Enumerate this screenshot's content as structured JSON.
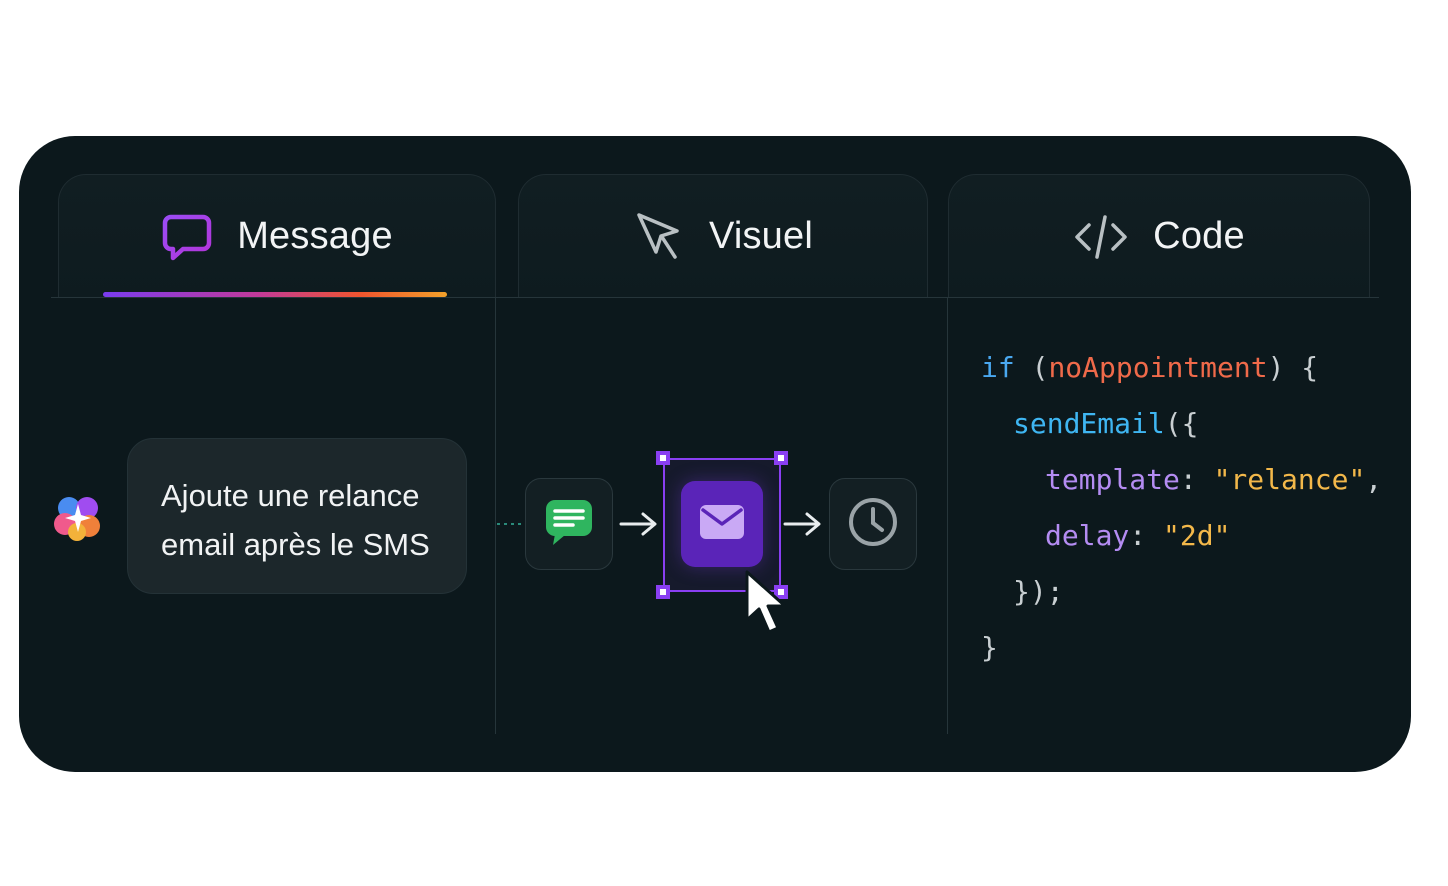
{
  "tabs": [
    {
      "id": "message",
      "label": "Message",
      "icon": "chat-bubble-icon",
      "active": true
    },
    {
      "id": "visuel",
      "label": "Visuel",
      "icon": "cursor-arrow-icon",
      "active": false
    },
    {
      "id": "code",
      "label": "Code",
      "icon": "code-brackets-icon",
      "active": false
    }
  ],
  "message_panel": {
    "ai_icon": "ai-sparkle-logo-icon",
    "prompt_line1": "Ajoute une relance",
    "prompt_line2": "email après le SMS"
  },
  "visual_panel": {
    "nodes": [
      {
        "id": "sms",
        "icon": "sms-message-icon",
        "color": "#2fb55f"
      },
      {
        "id": "email",
        "icon": "email-envelope-icon",
        "color": "#5a24b8",
        "selected": true
      },
      {
        "id": "delay",
        "icon": "clock-icon",
        "color": "#9aa3a7"
      }
    ],
    "selection_color": "#8a3ff2"
  },
  "code_panel": {
    "lines": [
      {
        "t1": "if",
        "t2": " (",
        "t3": "noAppointment",
        "t4": ") {"
      },
      {
        "t1": "sendEmail",
        "t2": "({"
      },
      {
        "t1": "template",
        "t2": ": ",
        "t3": "\"relance\"",
        "t4": ","
      },
      {
        "t1": "delay",
        "t2": ": ",
        "t3": "\"2d\""
      },
      {
        "t1": "});"
      },
      {
        "t1": "}"
      }
    ]
  },
  "colors": {
    "background": "#0c181c",
    "accent_gradient": [
      "#7a3cf0",
      "#c23a9a",
      "#f0552e",
      "#f3a12a"
    ]
  }
}
